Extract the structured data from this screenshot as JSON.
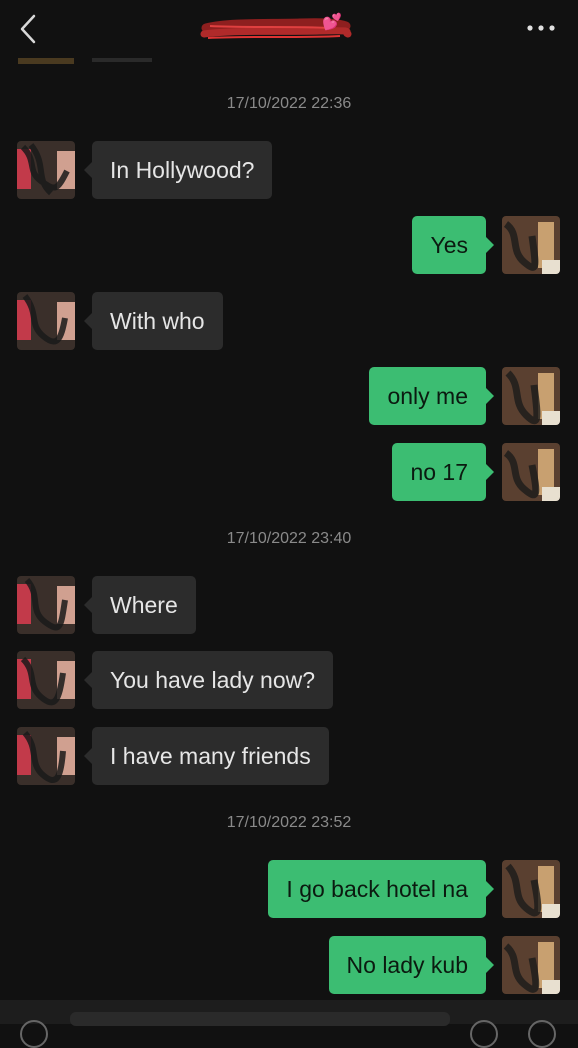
{
  "header": {
    "back_icon": "chevron-left-icon",
    "title_redacted": true,
    "more_icon": "ellipsis-icon",
    "emoji": "💕"
  },
  "colors": {
    "background": "#111111",
    "incoming_bubble": "#2c2c2c",
    "outgoing_bubble": "#3cbd72",
    "timestamp": "#8a8a8a"
  },
  "messages": [
    {
      "type": "timestamp",
      "text": "17/10/2022 22:36"
    },
    {
      "type": "message",
      "side": "in",
      "text": "In Hollywood?"
    },
    {
      "type": "message",
      "side": "out",
      "text": "Yes"
    },
    {
      "type": "message",
      "side": "in",
      "text": "With who"
    },
    {
      "type": "message",
      "side": "out",
      "text": "only me"
    },
    {
      "type": "message",
      "side": "out",
      "text": "no 17"
    },
    {
      "type": "timestamp",
      "text": "17/10/2022 23:40"
    },
    {
      "type": "message",
      "side": "in",
      "text": "Where"
    },
    {
      "type": "message",
      "side": "in",
      "text": "You have lady now?"
    },
    {
      "type": "message",
      "side": "in",
      "text": "I have many friends"
    },
    {
      "type": "timestamp",
      "text": "17/10/2022 23:52"
    },
    {
      "type": "message",
      "side": "out",
      "text": "I go back hotel na"
    },
    {
      "type": "message",
      "side": "out",
      "text": "No lady kub"
    }
  ]
}
